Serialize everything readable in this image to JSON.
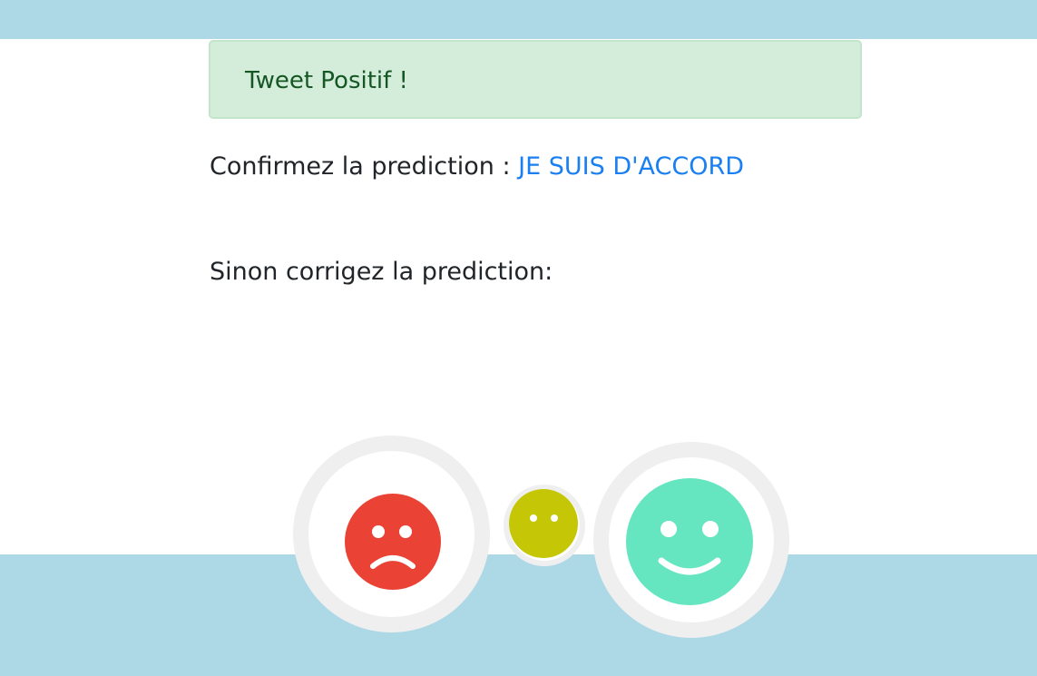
{
  "alert": {
    "text": "Tweet Positif !"
  },
  "confirm": {
    "label": "Confirmez la prediction : ",
    "link_text": "JE SUIS D'ACCORD"
  },
  "correct": {
    "label": "Sinon corrigez la prediction:"
  },
  "faces": [
    {
      "name": "sad-face-icon",
      "color": "#ea4335"
    },
    {
      "name": "neutral-face-icon",
      "color": "#c5c706"
    },
    {
      "name": "happy-face-icon",
      "color": "#65e6c0"
    }
  ],
  "colors": {
    "band": "#add8e6",
    "alert_bg": "#d4edda",
    "alert_text": "#155724",
    "link": "#1a7ff0",
    "ring": "#efefef"
  }
}
